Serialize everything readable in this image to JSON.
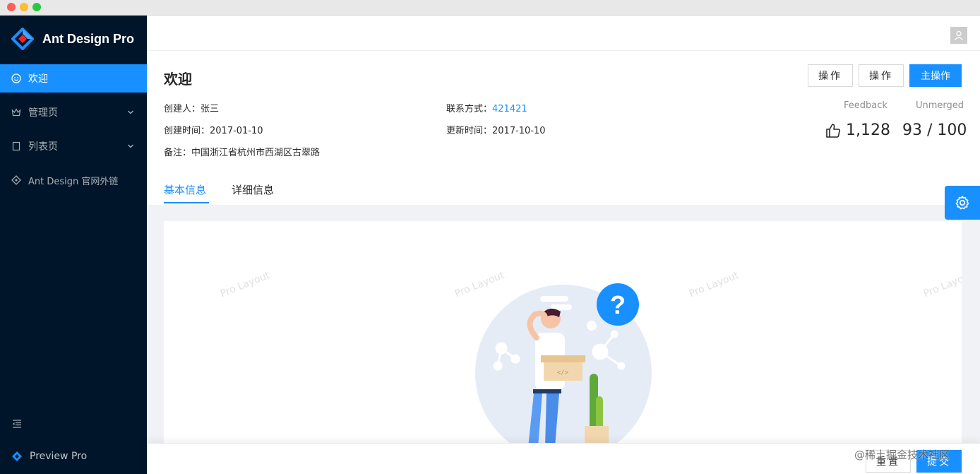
{
  "app": {
    "title": "Ant Design Pro",
    "brand_color": "#1890ff",
    "sider_color": "#001529"
  },
  "sidebar": {
    "items": [
      {
        "label": "欢迎",
        "icon": "smile-icon",
        "active": true
      },
      {
        "label": "管理页",
        "icon": "crown-icon",
        "has_children": true
      },
      {
        "label": "列表页",
        "icon": "table-icon",
        "has_children": true
      },
      {
        "label": "Ant Design 官网外链",
        "icon": "diamond-icon"
      }
    ],
    "collapse_icon": "menu-fold-icon",
    "footer_label": "Preview Pro"
  },
  "header": {
    "avatar_icon": "user-icon"
  },
  "page_header": {
    "title": "欢迎",
    "actions": [
      "操作",
      "操作",
      "主操作"
    ],
    "descriptions": {
      "creator_label": "创建人：",
      "creator_value": "张三",
      "contact_label": "联系方式：",
      "contact_value": "421421",
      "created_label": "创建时间：",
      "created_value": "2017-01-10",
      "updated_label": "更新时间：",
      "updated_value": "2017-10-10",
      "remark_label": "备注：",
      "remark_value": "中国浙江省杭州市西湖区古翠路"
    },
    "stats": {
      "feedback_label": "Feedback",
      "feedback_value": "1,128",
      "unmerged_label": "Unmerged",
      "unmerged_value": "93 / 100"
    },
    "tabs": [
      {
        "label": "基本信息",
        "active": true
      },
      {
        "label": "详细信息",
        "active": false
      }
    ]
  },
  "content": {
    "watermark": "Pro Layout"
  },
  "footer": {
    "reset_label": "重置",
    "submit_label": "提交"
  },
  "overlay": {
    "juejin": "@稀土掘金技术社区"
  }
}
